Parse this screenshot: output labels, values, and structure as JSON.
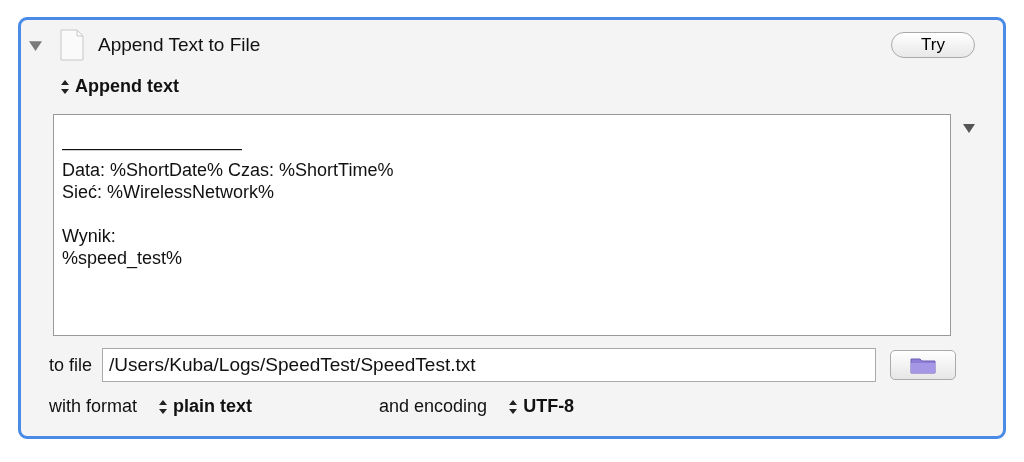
{
  "action": {
    "title": "Append Text to File",
    "expanded": true,
    "try_button": "Try"
  },
  "mode_popup": {
    "value": "Append text"
  },
  "text_area": {
    "paragraphs": [
      [
        "——————————",
        "Data: %ShortDate% Czas: %ShortTime%",
        "Sieć: %WirelessNetwork%"
      ],
      [
        "Wynik:",
        "%speed_test%"
      ]
    ]
  },
  "file_row": {
    "label": "to file",
    "value": "/Users/Kuba/Logs/SpeedTest/SpeedTest.txt"
  },
  "format_row": {
    "format_label": "with format",
    "format_value": "plain text",
    "encoding_label": "and encoding",
    "encoding_value": "UTF-8"
  }
}
